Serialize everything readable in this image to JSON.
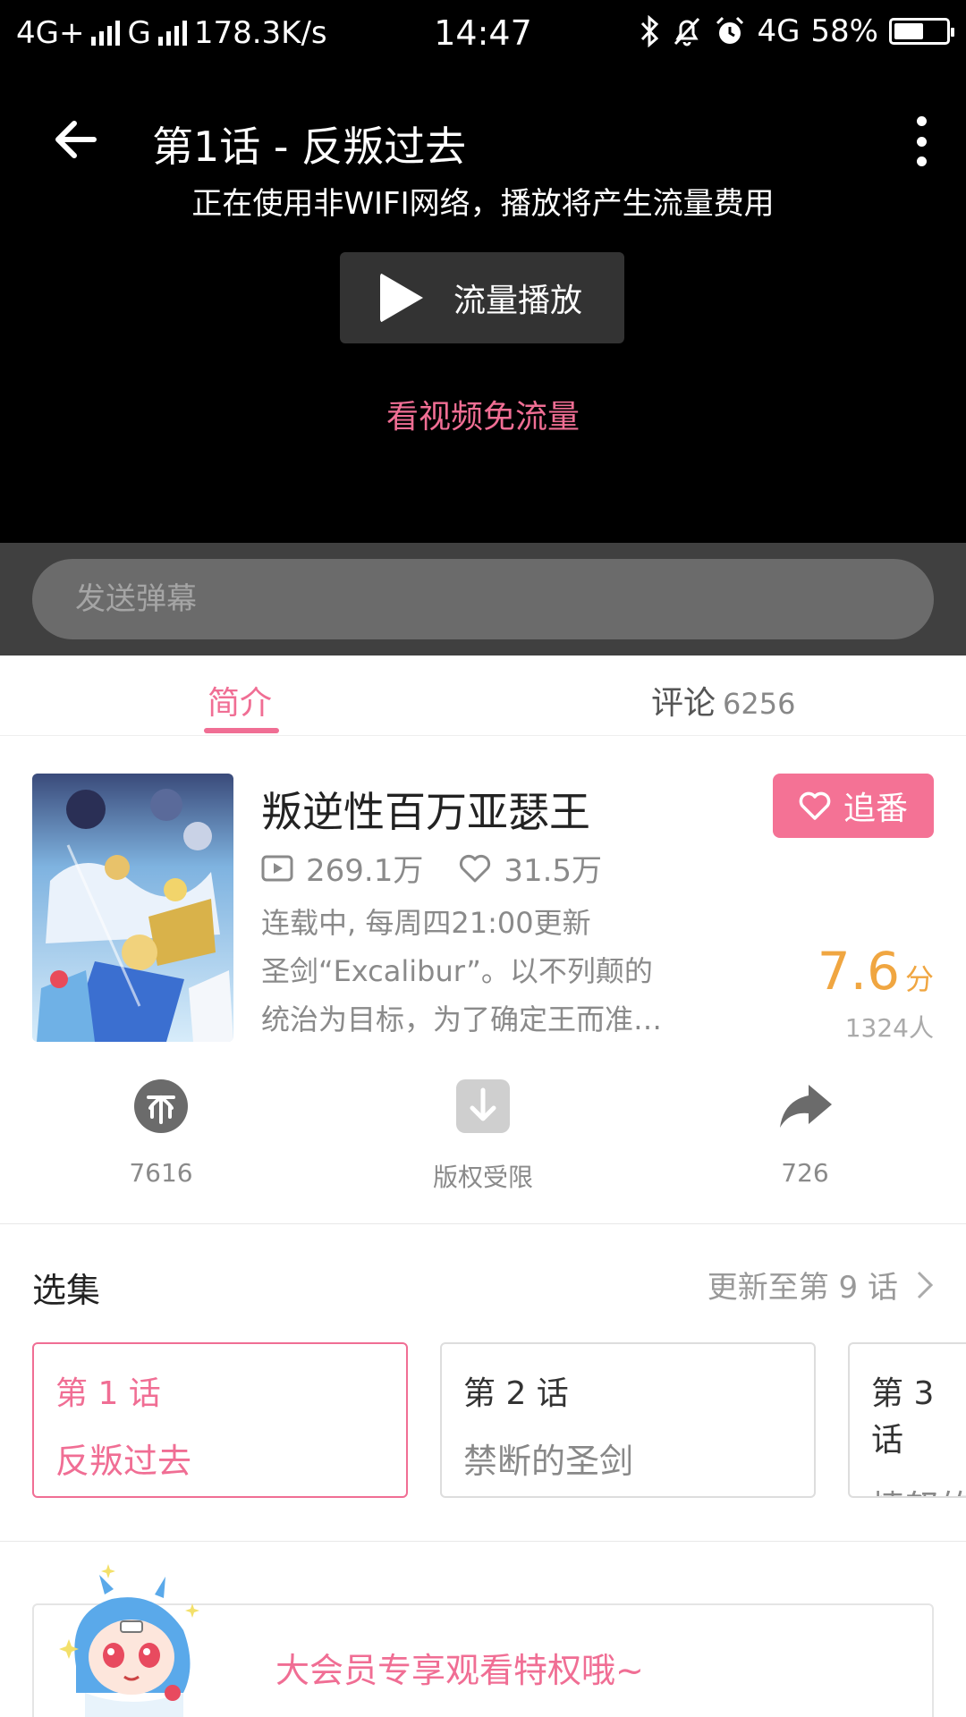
{
  "status_bar": {
    "net1": "4G+",
    "net2": "G",
    "speed": "178.3K/s",
    "time": "14:47",
    "net3": "4G",
    "battery": "58%",
    "battery_level": 0.58
  },
  "player": {
    "episode_title": "第1话 - 反叛过去",
    "network_warning": "正在使用非WIFI网络，播放将产生流量费用",
    "play_button_label": "流量播放",
    "free_data_link": "看视频免流量"
  },
  "danmaku": {
    "placeholder": "发送弹幕"
  },
  "tabs": {
    "intro": "简介",
    "comments": "评论",
    "comments_count": "6256"
  },
  "show": {
    "title": "叛逆性百万亚瑟王",
    "follow_label": "追番",
    "plays": "269.1万",
    "likes": "31.5万",
    "schedule": "连载中, 每周四21:00更新",
    "desc_line1": "圣剑“Excalibur”。以不列颠的",
    "desc_line2": "统治为目标，为了确定王而准…",
    "score": "7.6",
    "score_unit": "分",
    "raters": "1324人"
  },
  "actions": {
    "coin_count": "7616",
    "download_label": "版权受限",
    "share_count": "726"
  },
  "episodes": {
    "heading": "选集",
    "update_info": "更新至第 9 话",
    "items": [
      {
        "num": "第 1 话",
        "title": "反叛过去"
      },
      {
        "num": "第 2 话",
        "title": "禁断的圣剑"
      },
      {
        "num": "第 3 话",
        "title": "愤怒的"
      }
    ]
  },
  "vip": {
    "text": "大会员专享观看特权哦~"
  },
  "colors": {
    "accent_pink": "#f06e94",
    "score_orange": "#f0a641"
  }
}
